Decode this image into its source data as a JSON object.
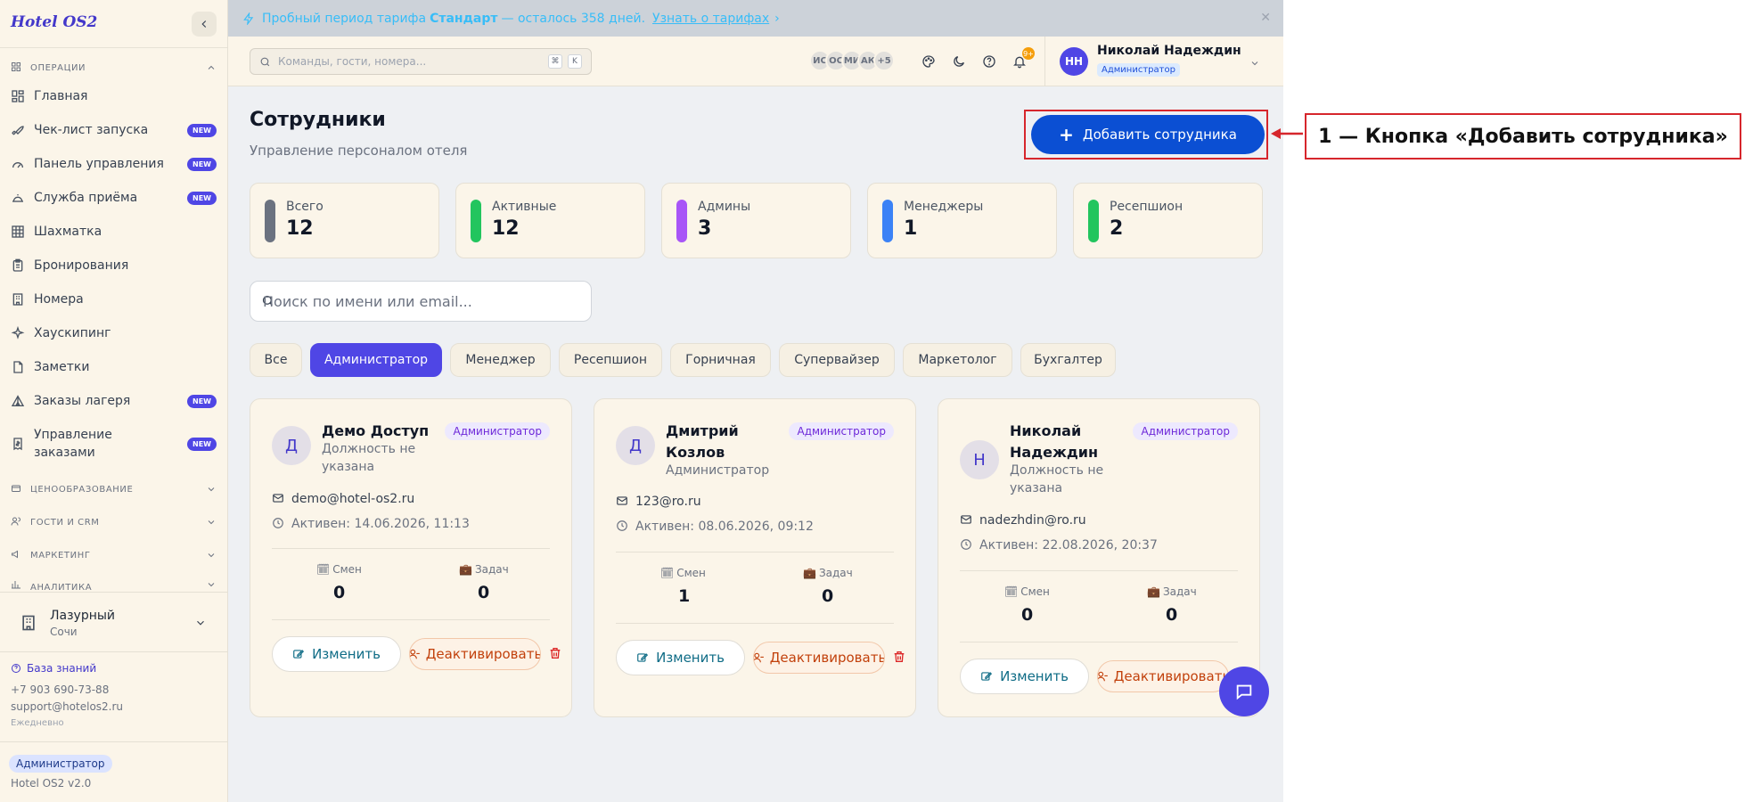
{
  "app": {
    "logo": "Hotel OS2",
    "version": "Hotel OS2 v2.0"
  },
  "trial": {
    "prefix": "Пробный период тарифа",
    "plan": "Стандарт",
    "suffix": "— осталось 358 дней.",
    "link": "Узнать о тарифах",
    "link_arrow": "›"
  },
  "sidebar": {
    "sections": [
      {
        "label": "ОПЕРАЦИИ",
        "icon": "grid-icon",
        "expanded": true
      },
      {
        "label": "ЦЕНООБРАЗОВАНИЕ",
        "icon": "wallet-icon"
      },
      {
        "label": "ГОСТИ И CRM",
        "icon": "users-icon"
      },
      {
        "label": "МАРКЕТИНГ",
        "icon": "megaphone-icon"
      },
      {
        "label": "АНАЛИТИКА",
        "icon": "chart-icon"
      }
    ],
    "items": [
      {
        "label": "Главная",
        "icon": "grid-icon"
      },
      {
        "label": "Чек-лист запуска",
        "icon": "rocket-icon",
        "badge": "NEW"
      },
      {
        "label": "Панель управления",
        "icon": "gauge-icon",
        "badge": "NEW"
      },
      {
        "label": "Служба приёма",
        "icon": "bell-desk-icon",
        "badge": "NEW"
      },
      {
        "label": "Шахматка",
        "icon": "table-icon"
      },
      {
        "label": "Бронирования",
        "icon": "clipboard-icon"
      },
      {
        "label": "Номера",
        "icon": "building-icon"
      },
      {
        "label": "Хаускипинг",
        "icon": "sparkle-icon"
      },
      {
        "label": "Заметки",
        "icon": "note-icon"
      },
      {
        "label": "Заказы лагеря",
        "icon": "tent-icon",
        "badge": "NEW"
      },
      {
        "label": "Управление заказами",
        "icon": "receipt-icon",
        "badge": "NEW"
      }
    ],
    "hotel": {
      "name": "Лазурный",
      "city": "Сочи"
    },
    "footer": {
      "kb": "База знаний",
      "phone": "+7 903 690-73-88",
      "email": "support@hotelos2.ru",
      "hours": "Ежедневно",
      "role": "Администратор"
    }
  },
  "topbar": {
    "search_placeholder": "Команды, гости, номера...",
    "kbd1": "⌘",
    "kbd2": "K",
    "avatars": [
      "ИС",
      "ОС",
      "МИ",
      "АК",
      "+5"
    ],
    "notif_count": "9+",
    "user": {
      "initials": "НН",
      "name": "Николай Надеждин",
      "role": "Администратор"
    }
  },
  "page": {
    "title": "Сотрудники",
    "subtitle": "Управление персоналом отеля",
    "add_button": "Добавить сотрудника"
  },
  "stats": [
    {
      "label": "Всего",
      "value": "12",
      "color": "#6b7280"
    },
    {
      "label": "Активные",
      "value": "12",
      "color": "#22c55e"
    },
    {
      "label": "Админы",
      "value": "3",
      "color": "#a855f7"
    },
    {
      "label": "Менеджеры",
      "value": "1",
      "color": "#3b82f6"
    },
    {
      "label": "Ресепшион",
      "value": "2",
      "color": "#22c55e"
    }
  ],
  "employee_search": {
    "placeholder": "Поиск по имени или email..."
  },
  "filters": [
    "Все",
    "Администратор",
    "Менеджер",
    "Ресепшион",
    "Горничная",
    "Супервайзер",
    "Маркетолог",
    "Бухгалтер"
  ],
  "filter_active": "Администратор",
  "employees": [
    {
      "initial": "Д",
      "name": "Демо Доступ",
      "position": "Должность не указана",
      "role": "Администратор",
      "email": "demo@hotel-os2.ru",
      "active": "Активен: 14.06.2026, 11:13",
      "shifts_label": "Смен",
      "shifts": "0",
      "tasks_label": "Задач",
      "tasks": "0",
      "edit": "Изменить",
      "deactivate": "Деактивировать"
    },
    {
      "initial": "Д",
      "name": "Дмитрий Козлов",
      "position": "Администратор",
      "role": "Администратор",
      "email": "123@ro.ru",
      "active": "Активен: 08.06.2026, 09:12",
      "shifts_label": "Смен",
      "shifts": "1",
      "tasks_label": "Задач",
      "tasks": "0",
      "edit": "Изменить",
      "deactivate": "Деактивировать"
    },
    {
      "initial": "Н",
      "name": "Николай Надеждин",
      "position": "Должность не указана",
      "role": "Администратор",
      "email": "nadezhdin@ro.ru",
      "active": "Активен: 22.08.2026, 20:37",
      "shifts_label": "Смен",
      "shifts": "0",
      "tasks_label": "Задач",
      "tasks": "0",
      "edit": "Изменить",
      "deactivate": "Деактивировать"
    }
  ],
  "annotation": {
    "label": "1 — Кнопка «Добавить сотрудника»",
    "color": "#d6262c"
  },
  "colors": {
    "accent": "#4f46e5",
    "primary_button": "#0b4fd3",
    "sidebar_bg": "#fbf5e9",
    "card_bg": "#fbf5e9"
  }
}
